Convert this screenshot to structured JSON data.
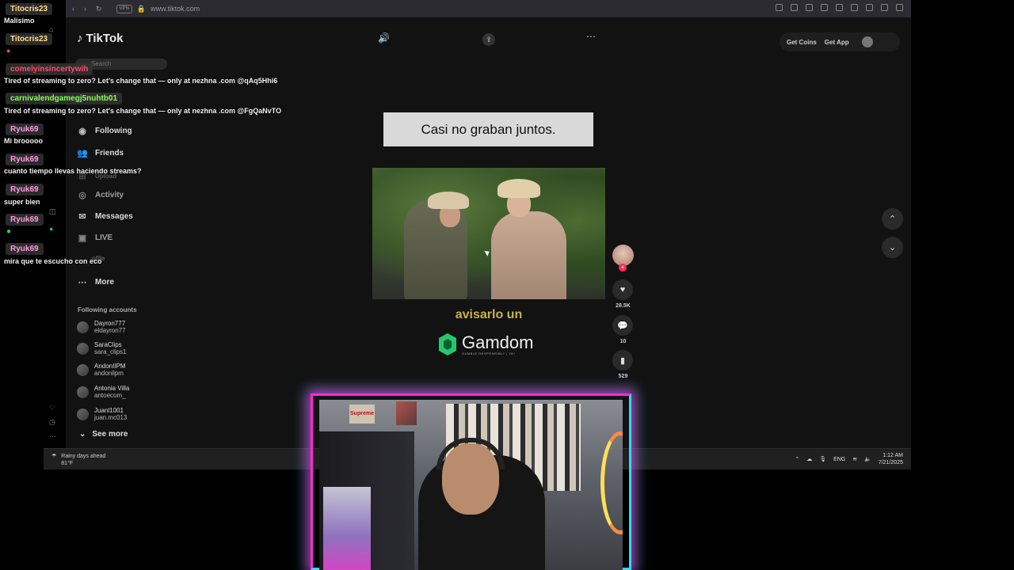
{
  "browser": {
    "url": "www.tiktok.com",
    "vpn_badge": "VPN"
  },
  "tiktok": {
    "logo_text": "TikTok",
    "search_placeholder": "Search",
    "nav": {
      "following": "Following",
      "friends": "Friends",
      "upload_partial": "Upload",
      "activity": "Activity",
      "messages": "Messages",
      "live": "LIVE",
      "profile_partial": "ofile",
      "more": "More"
    },
    "following_accounts_title": "Following accounts",
    "following_accounts": [
      {
        "name": "Dayron777",
        "handle": "eldayron77"
      },
      {
        "name": "SaraClips",
        "handle": "sara_clips1"
      },
      {
        "name": "AndonIIPM",
        "handle": "andonlipm"
      },
      {
        "name": "Antonia Villa",
        "handle": "antoecom_"
      },
      {
        "name": "Juanl1001",
        "handle": "juan.mc013"
      }
    ],
    "see_more": "See more",
    "header": {
      "get_coins": "Get Coins",
      "get_app": "Get App"
    },
    "video": {
      "caption": "Casi no graban juntos.",
      "subtitle": "avisarlo un",
      "sponsor_name": "Gamdom",
      "sponsor_tagline": "GAMBLE RESPONSIBLY | 18+"
    },
    "actions": {
      "likes": "28.5K",
      "comments": "10",
      "saves": "529"
    }
  },
  "chat": [
    {
      "user": "Titocris23",
      "color": "#ffe08a",
      "message": "Malisimo"
    },
    {
      "user": "Titocris23",
      "color": "#ffe08a",
      "message": ""
    },
    {
      "user": "comelyinsincertywih",
      "color": "#ff4d6d",
      "message": "Tired of streaming to zero? Let's change that — only at nezhna .com @qAq5Hhi6"
    },
    {
      "user": "carnivalendgamegj5nuhtb01",
      "color": "#8cff5a",
      "message": "Tired of streaming to zero? Let's change that — only at nezhna .com @FgQaNvTO"
    },
    {
      "user": "Ryuk69",
      "color": "#ff9de0",
      "message": "Mi brooooo"
    },
    {
      "user": "Ryuk69",
      "color": "#ff9de0",
      "message": "cuanto tiempo llevas haciendo streams?"
    },
    {
      "user": "Ryuk69",
      "color": "#ff9de0",
      "message": "super bien"
    },
    {
      "user": "Ryuk69",
      "color": "#ff9de0",
      "message": ""
    },
    {
      "user": "Ryuk69",
      "color": "#ff9de0",
      "message": "mira que te escucho con eco"
    }
  ],
  "taskbar": {
    "weather_title": "Rainy days ahead",
    "weather_temp": "81°F",
    "lang": "ENG",
    "time": "1:12 AM",
    "date": "7/21/2025"
  },
  "webcam": {
    "sticker_text": "Supreme"
  },
  "colors": {
    "tiktok_red": "#fe2c55",
    "glow_pink": "#ff2ad4",
    "glow_cyan": "#35d6ff"
  }
}
